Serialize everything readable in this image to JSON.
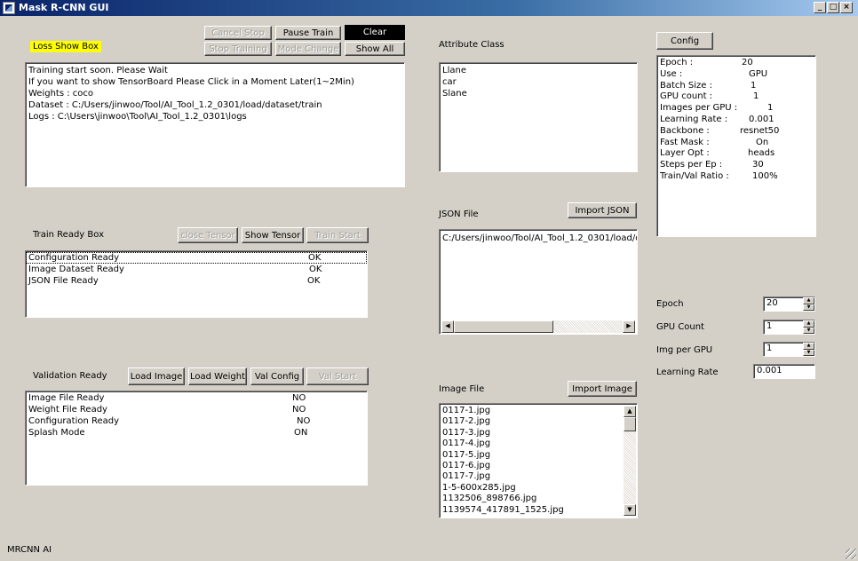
{
  "window": {
    "title": "Mask R-CNN GUI",
    "status": "MRCNN AI"
  },
  "loss": {
    "label": "Loss Show Box",
    "buttons": {
      "cancel_stop": "Cancel Stop",
      "pause_train": "Pause Train",
      "clear": "Clear",
      "stop_training": "Stop Training",
      "mode_change": "Mode Change",
      "show_all": "Show All"
    },
    "lines": [
      "Training start soon. Please Wait",
      "If you want to show TensorBoard Please Click in a Moment Later(1~2Min)",
      "Weights : coco",
      "Dataset : C:/Users/jinwoo/Tool/AI_Tool_1.2_0301/load/dataset/train",
      "Logs : C:\\Users\\jinwoo\\Tool\\AI_Tool_1.2_0301\\logs"
    ]
  },
  "train_ready": {
    "label": "Train Ready Box",
    "buttons": {
      "close_tensor": "close Tensor",
      "show_tensor": "Show Tensor",
      "train_start": "Train Start"
    },
    "rows": [
      {
        "name": "Configuration Ready",
        "status": "OK"
      },
      {
        "name": "Image Dataset Ready",
        "status": "OK"
      },
      {
        "name": "JSON File Ready",
        "status": "OK"
      }
    ]
  },
  "validation": {
    "label": "Validation Ready",
    "buttons": {
      "load_image": "Load Image",
      "load_weight": "Load Weight",
      "val_config": "Val Config",
      "val_start": "Val Start"
    },
    "rows": [
      {
        "name": "Image File Ready",
        "status": "NO"
      },
      {
        "name": "Weight File Ready",
        "status": "NO"
      },
      {
        "name": "Configuration Ready",
        "status": "NO"
      },
      {
        "name": "Splash Mode",
        "status": "ON"
      }
    ]
  },
  "attribute": {
    "label": "Attribute Class",
    "items": [
      "Llane",
      "car",
      "Slane"
    ]
  },
  "json": {
    "label": "JSON File",
    "button": "Import JSON",
    "path": "C:/Users/jinwoo/Tool/AI_Tool_1.2_0301/load/d"
  },
  "image": {
    "label": "Image File",
    "button": "Import Image",
    "files": [
      "0117-1.jpg",
      "0117-2.jpg",
      "0117-3.jpg",
      "0117-4.jpg",
      "0117-5.jpg",
      "0117-6.jpg",
      "0117-7.jpg",
      "1-5-600x285.jpg",
      "1132506_898766.jpg",
      "1139574_417891_1525.jpg"
    ]
  },
  "config": {
    "button": "Config",
    "entries": [
      {
        "key": "Epoch :",
        "value": "20"
      },
      {
        "key": "Use :",
        "value": "GPU"
      },
      {
        "key": "Batch Size :",
        "value": "1"
      },
      {
        "key": "GPU count :",
        "value": "1"
      },
      {
        "key": "Images per GPU :",
        "value": "1"
      },
      {
        "key": "Learning Rate :",
        "value": "0.001"
      },
      {
        "key": "Backbone :",
        "value": "resnet50"
      },
      {
        "key": "Fast Mask :",
        "value": "On"
      },
      {
        "key": "Layer Opt :",
        "value": "heads"
      },
      {
        "key": "Steps per Ep :",
        "value": "30"
      },
      {
        "key": "Train/Val Ratio :",
        "value": "100%"
      }
    ]
  },
  "settings": {
    "epoch_label": "Epoch",
    "epoch": "20",
    "gpu_count_label": "GPU Count",
    "gpu_count": "1",
    "img_per_gpu_label": "Img per GPU",
    "img_per_gpu": "1",
    "lr_label": "Learning Rate",
    "lr": "0.001"
  }
}
